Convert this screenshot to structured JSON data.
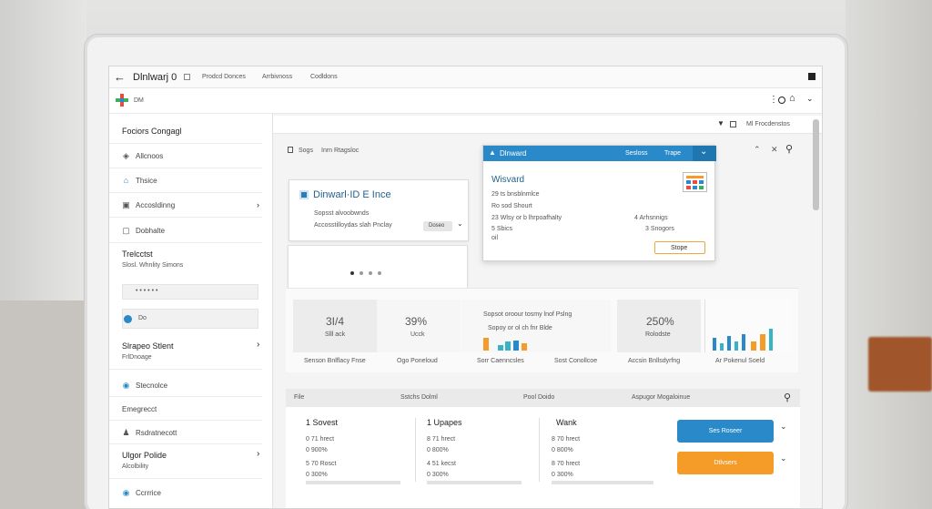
{
  "window": {
    "title": "Dlnlwarj 0",
    "tabs": [
      "Prodcd Donces",
      "Arrbivnoss",
      "Codldons"
    ]
  },
  "address": {
    "label": "DM"
  },
  "sidebar": {
    "header": "Fociors Congagl",
    "items": [
      {
        "label": "Allcnoos",
        "icon": "signal-icon"
      },
      {
        "label": "Thsice",
        "icon": "home-icon"
      },
      {
        "label": "Accosldinng",
        "icon": "folder-icon"
      },
      {
        "label": "Dobhalte",
        "icon": "lock-icon"
      }
    ],
    "section1_title": "Trelcctst",
    "section1_sub": "Slosl. Whnlity Simons",
    "field1": "• • • • • •",
    "field2": "Do",
    "section2_title": "Slrapeo Stlent",
    "section2_sub": "FrlDnoage",
    "items2": [
      {
        "label": "Stecnolce",
        "icon": "shield-icon"
      },
      {
        "label": "Emegrecct",
        "icon": "none"
      },
      {
        "label": "Rsdratnecott",
        "icon": "user-icon"
      }
    ],
    "section3_title": "Ulgor Polide",
    "section3_sub": "Alcolbility",
    "bottom_item": "Ccrrrice"
  },
  "toolbar": {
    "right_label": "Ml Frocdenstos"
  },
  "search_row": {
    "label": "Sogs",
    "text": "Inrn Rtagsloc"
  },
  "card1": {
    "title": "Dinwarl·ID E Ince",
    "line1": "Sopsst alvoobwnds",
    "line2": "Accosstilloydas slah Pnclay",
    "select_label": "Doseo"
  },
  "popup": {
    "header": "Dlnward",
    "tab1": "Sesloss",
    "tab2": "Trape",
    "title": "Wisvard",
    "l1": "29 ts bnsblnmlce",
    "l2": "Ro sod Shourt",
    "l3": "23 Wlsy or b lhrpoafhalty",
    "l4": "5 Sbics",
    "l5": "oil",
    "r1": "4 Arhsnnigs",
    "r2": "3 Snogors",
    "button": "Stope"
  },
  "stats": {
    "boxes": [
      {
        "value": "3I/4",
        "label": "Slll ack",
        "caption": "Senson Bnlflacy Fnse"
      },
      {
        "value": "39%",
        "label": "Ucck",
        "caption": "Ogo Poneloud"
      },
      {
        "value": "",
        "label": "",
        "caption": "Sorr Caenncsles"
      },
      {
        "value": "",
        "label": "",
        "caption": "Sost Conollcoe"
      },
      {
        "value": "250%",
        "label": "Rolodste",
        "caption": "Accsin Bnllsdyrfng"
      },
      {
        "value": "",
        "label": "",
        "caption": "Ar Pokenul Soeld"
      }
    ],
    "mid_title": "Sopsot oroour tosmy lnof Pslng",
    "mid_sub": "Sopoy or ol ch fnr Blde"
  },
  "table": {
    "headers": [
      "File",
      "Sstchs Dolml",
      "Pool Doido",
      "Aspugor Mogaloinue"
    ],
    "col1_title": "1 Sovest",
    "col2_title": "1 Upapes",
    "col3_title": "Wank",
    "col1": [
      "0 71 hrect",
      "0 900%",
      "5 70 Rosct",
      "0 300%"
    ],
    "col2": [
      "8 71 hrect",
      "0 800%",
      "4 51 kecst",
      "0 300%"
    ],
    "col3": [
      "8 70 hrect",
      "0 800%",
      "8 70 hrect",
      "0 300%"
    ],
    "btn_blue": "Ses Roseer",
    "btn_orange": "Dtlvsers"
  },
  "colors": {
    "accent_blue": "#2a8ac9",
    "accent_orange": "#f59b27",
    "teal": "#36b3c6"
  }
}
